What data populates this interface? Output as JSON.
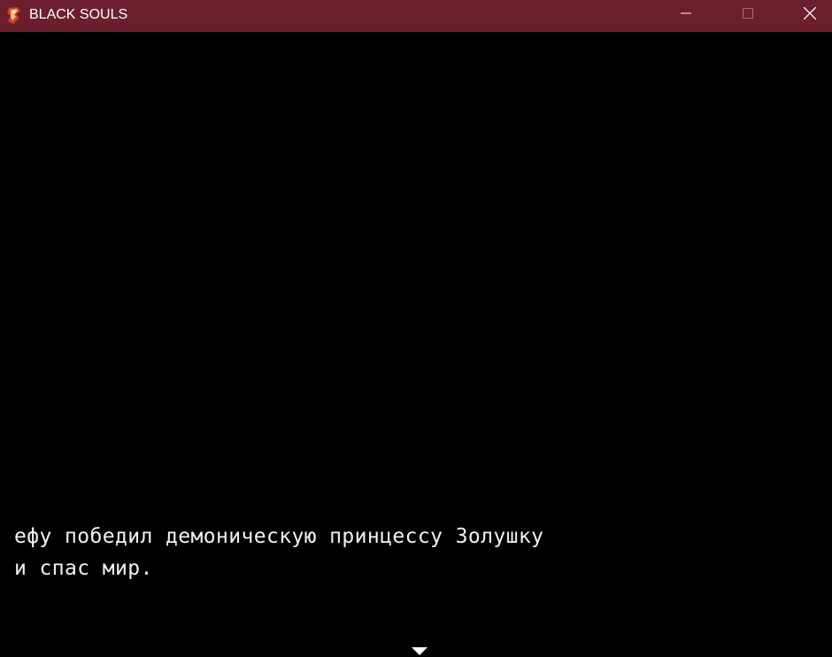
{
  "window": {
    "title": "BLACK SOULS",
    "titlebar_color": "#6b1f2c",
    "background_color": "#000000",
    "controls": {
      "minimize_icon": "minimize-icon",
      "maximize_icon": "maximize-icon",
      "close_icon": "close-icon"
    },
    "app_icon": "black-souls-app-icon"
  },
  "message": {
    "lines": [
      "ефу победил демоническую принцессу Золушку",
      "и спас мир."
    ],
    "text_color": "#f2f2f2",
    "continue_indicator": "down-arrow-icon"
  }
}
